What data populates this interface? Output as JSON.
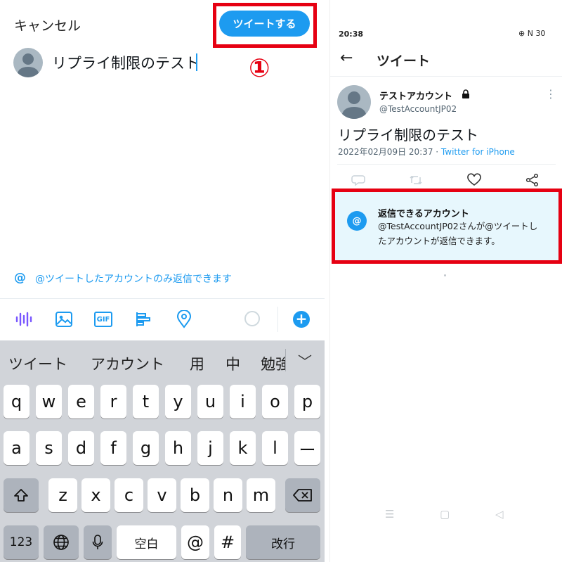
{
  "compose": {
    "cancel_label": "キャンセル",
    "tweet_button_label": "ツイートする",
    "annotation_number": "①",
    "text": "リプライ制限のテスト",
    "reply_setting_icon": "@",
    "reply_setting_label": "@ツイートしたアカウントのみ返信できます",
    "toolbar": {
      "icons": [
        "audio-waveform-icon",
        "image-icon",
        "gif-icon",
        "poll-icon",
        "location-pin-icon"
      ],
      "gif_label": "GIF",
      "add_label": "+"
    }
  },
  "keyboard": {
    "suggestions": [
      "ツイート",
      "アカウント",
      "用",
      "中",
      "勉強"
    ],
    "row1": [
      "q",
      "w",
      "e",
      "r",
      "t",
      "y",
      "u",
      "i",
      "o",
      "p"
    ],
    "row2": [
      "a",
      "s",
      "d",
      "f",
      "g",
      "h",
      "j",
      "k",
      "l",
      "ー"
    ],
    "row3": [
      "z",
      "x",
      "c",
      "v",
      "b",
      "n",
      "m"
    ],
    "numbers_label": "123",
    "space_label": "空白",
    "at_label": "@",
    "hash_label": "#",
    "return_label": "改行"
  },
  "detail": {
    "status_time": "20:38",
    "status_right": "⊕ N 30",
    "header_title": "ツイート",
    "account_name": "テストアカウント",
    "account_handle": "@TestAccountJP02",
    "tweet_text": "リプライ制限のテスト",
    "tweet_date": "2022年02月09日 20:37 · ",
    "tweet_source": "Twitter for iPhone",
    "reply_restriction_title": "返信できるアカウント",
    "reply_restriction_desc": "@TestAccountJP02さんが@ツイートしたアカウントが返信できます。",
    "reply_icon_text": "@"
  },
  "colors": {
    "accent": "#1d9bf0",
    "highlight": "#e60012",
    "reply_box_bg": "#e7f7fd",
    "keyboard_bg": "#d1d4d9"
  }
}
